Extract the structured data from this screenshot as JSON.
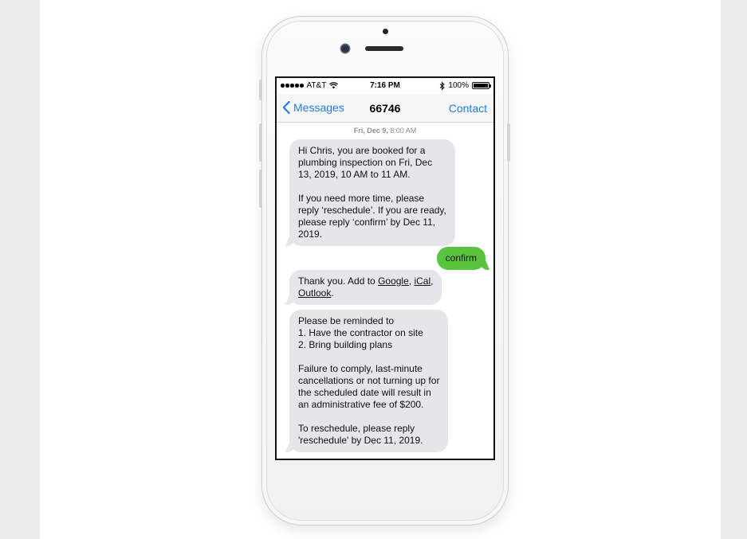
{
  "status_bar": {
    "carrier": "AT&T",
    "time": "7:16 PM",
    "battery": "100%",
    "battery_level": 1.0,
    "icons": [
      "signal-dots-icon",
      "wifi-icon",
      "bluetooth-icon",
      "battery-icon"
    ]
  },
  "nav": {
    "back_label": "Messages",
    "title": "66746",
    "right_label": "Contact",
    "accent_color": "#1a7ef5"
  },
  "thread": {
    "timestamp_day": "Fri, Dec 9,",
    "timestamp_time": "8:00 AM",
    "messages": [
      {
        "direction": "incoming",
        "lines": [
          "Hi Chris, you are booked for a",
          "plumbing inspection on Fri, Dec",
          "13, 2019, 10 AM to 11 AM.",
          "",
          "If you need more time, please",
          "reply ‘reschedule’. If you are ready,",
          "please reply ‘confirm’ by Dec 11,",
          "2019."
        ]
      },
      {
        "direction": "outgoing",
        "text": "confirm"
      },
      {
        "direction": "incoming",
        "prefix": "Thank you. Add to ",
        "link1": "Google",
        "sep1": ", ",
        "link2": "iCal",
        "sep2": ",",
        "link3": "Outlook",
        "suffix": "."
      },
      {
        "direction": "incoming",
        "lines": [
          "Please be reminded to",
          "1. Have the contractor on site",
          "2. Bring building plans",
          "",
          "Failure to comply, last-minute",
          "cancellations or not turning up for",
          "the scheduled date will result in",
          "an administrative fee of $200.",
          "",
          "To reschedule, please reply",
          "'reschedule' by Dec 11, 2019."
        ]
      }
    ]
  },
  "colors": {
    "incoming_bubble": "#e5e5ea",
    "outgoing_bubble": "#5ac43c"
  }
}
